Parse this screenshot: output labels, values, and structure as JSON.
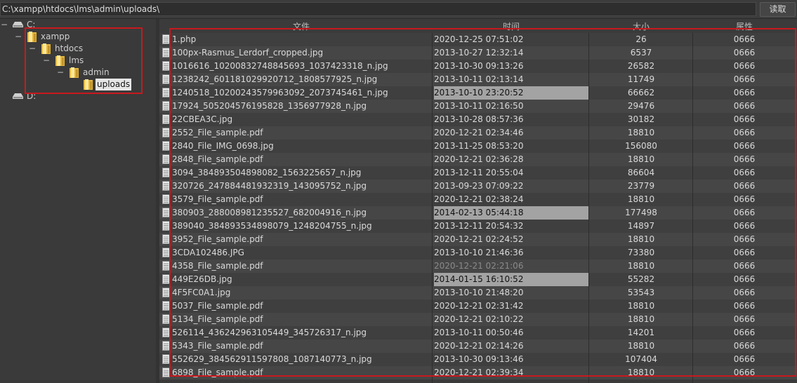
{
  "toolbar": {
    "path_value": "C:\\xampp\\htdocs\\lms\\admin\\uploads\\",
    "read_label": "读取"
  },
  "tree": {
    "drive_c": {
      "toggle": "−",
      "label": "C:",
      "icon": "drive-icon"
    },
    "xampp": {
      "toggle": "−",
      "label": "xampp",
      "icon": "folder-icon"
    },
    "htdocs": {
      "toggle": "−",
      "label": "htdocs",
      "icon": "folder-icon"
    },
    "lms": {
      "toggle": "−",
      "label": "lms",
      "icon": "folder-icon"
    },
    "admin": {
      "toggle": "−",
      "label": "admin",
      "icon": "folder-icon"
    },
    "uploads": {
      "label": "uploads",
      "icon": "folder-icon"
    },
    "drive_d": {
      "label": "D:",
      "icon": "drive-icon"
    }
  },
  "table": {
    "columns": [
      "文件",
      "时间",
      "大小",
      "属性"
    ],
    "rows": [
      {
        "name": "1.php",
        "time": "2020-12-25 07:51:02",
        "size": "26",
        "attr": "0666"
      },
      {
        "name": "100px-Rasmus_Lerdorf_cropped.jpg",
        "time": "2013-10-27 12:32:14",
        "size": "6537",
        "attr": "0666"
      },
      {
        "name": "1016616_10200832748845693_1037423318_n.jpg",
        "time": "2013-10-30 09:13:26",
        "size": "26582",
        "attr": "0666"
      },
      {
        "name": "1238242_601181029920712_1808577925_n.jpg",
        "time": "2013-10-11 02:13:14",
        "size": "11749",
        "attr": "0666"
      },
      {
        "name": "1240518_10200243579963092_2073745461_n.jpg",
        "time": "2013-10-10 23:20:52",
        "size": "66662",
        "attr": "0666",
        "hl": true
      },
      {
        "name": "17924_505204576195828_1356977928_n.jpg",
        "time": "2013-10-11 02:16:50",
        "size": "29476",
        "attr": "0666"
      },
      {
        "name": "22CBEA3C.jpg",
        "time": "2013-10-28 08:57:36",
        "size": "30182",
        "attr": "0666"
      },
      {
        "name": "2552_File_sample.pdf",
        "time": "2020-12-21 02:34:46",
        "size": "18810",
        "attr": "0666"
      },
      {
        "name": "2840_File_IMG_0698.jpg",
        "time": "2013-11-25 08:53:20",
        "size": "156080",
        "attr": "0666"
      },
      {
        "name": "2848_File_sample.pdf",
        "time": "2020-12-21 02:36:28",
        "size": "18810",
        "attr": "0666"
      },
      {
        "name": "3094_384893504898082_1563225657_n.jpg",
        "time": "2013-12-11 20:55:04",
        "size": "86604",
        "attr": "0666"
      },
      {
        "name": "320726_247884481932319_143095752_n.jpg",
        "time": "2013-09-23 07:09:22",
        "size": "23779",
        "attr": "0666"
      },
      {
        "name": "3579_File_sample.pdf",
        "time": "2020-12-21 02:38:24",
        "size": "18810",
        "attr": "0666"
      },
      {
        "name": "380903_288008981235527_682004916_n.jpg",
        "time": "2014-02-13 05:44:18",
        "size": "177498",
        "attr": "0666",
        "hl": true
      },
      {
        "name": "389040_384893534898079_1248204755_n.jpg",
        "time": "2013-12-11 20:54:32",
        "size": "14897",
        "attr": "0666"
      },
      {
        "name": "3952_File_sample.pdf",
        "time": "2020-12-21 02:24:52",
        "size": "18810",
        "attr": "0666"
      },
      {
        "name": "3CDA102486.JPG",
        "time": "2013-10-10 21:46:36",
        "size": "73380",
        "attr": "0666"
      },
      {
        "name": "4358_File_sample.pdf",
        "time": "2020-12-21 02:21:06",
        "size": "18810",
        "attr": "0666",
        "dim": true
      },
      {
        "name": "449E26DB.jpg",
        "time": "2014-01-15 16:10:52",
        "size": "55282",
        "attr": "0666",
        "hl": true
      },
      {
        "name": "4F5FC0A1.jpg",
        "time": "2013-10-10 21:48:20",
        "size": "53543",
        "attr": "0666"
      },
      {
        "name": "5037_File_sample.pdf",
        "time": "2020-12-21 02:31:42",
        "size": "18810",
        "attr": "0666"
      },
      {
        "name": "5134_File_sample.pdf",
        "time": "2020-12-21 02:10:22",
        "size": "18810",
        "attr": "0666"
      },
      {
        "name": "526114_436242963105449_345726317_n.jpg",
        "time": "2013-10-11 00:50:46",
        "size": "14201",
        "attr": "0666"
      },
      {
        "name": "5343_File_sample.pdf",
        "time": "2020-12-21 02:14:26",
        "size": "18810",
        "attr": "0666"
      },
      {
        "name": "552629_384562911597808_1087140773_n.jpg",
        "time": "2013-10-30 09:13:46",
        "size": "107404",
        "attr": "0666"
      },
      {
        "name": "6898_File_sample.pdf",
        "time": "2020-12-21 02:39:34",
        "size": "18810",
        "attr": "0666"
      }
    ]
  },
  "colors": {
    "annotation": "#c8191d",
    "background": "#3a3a3a",
    "row_odd": "#3f3f3f",
    "row_even": "#464646",
    "highlight": "#a3a3a3"
  }
}
